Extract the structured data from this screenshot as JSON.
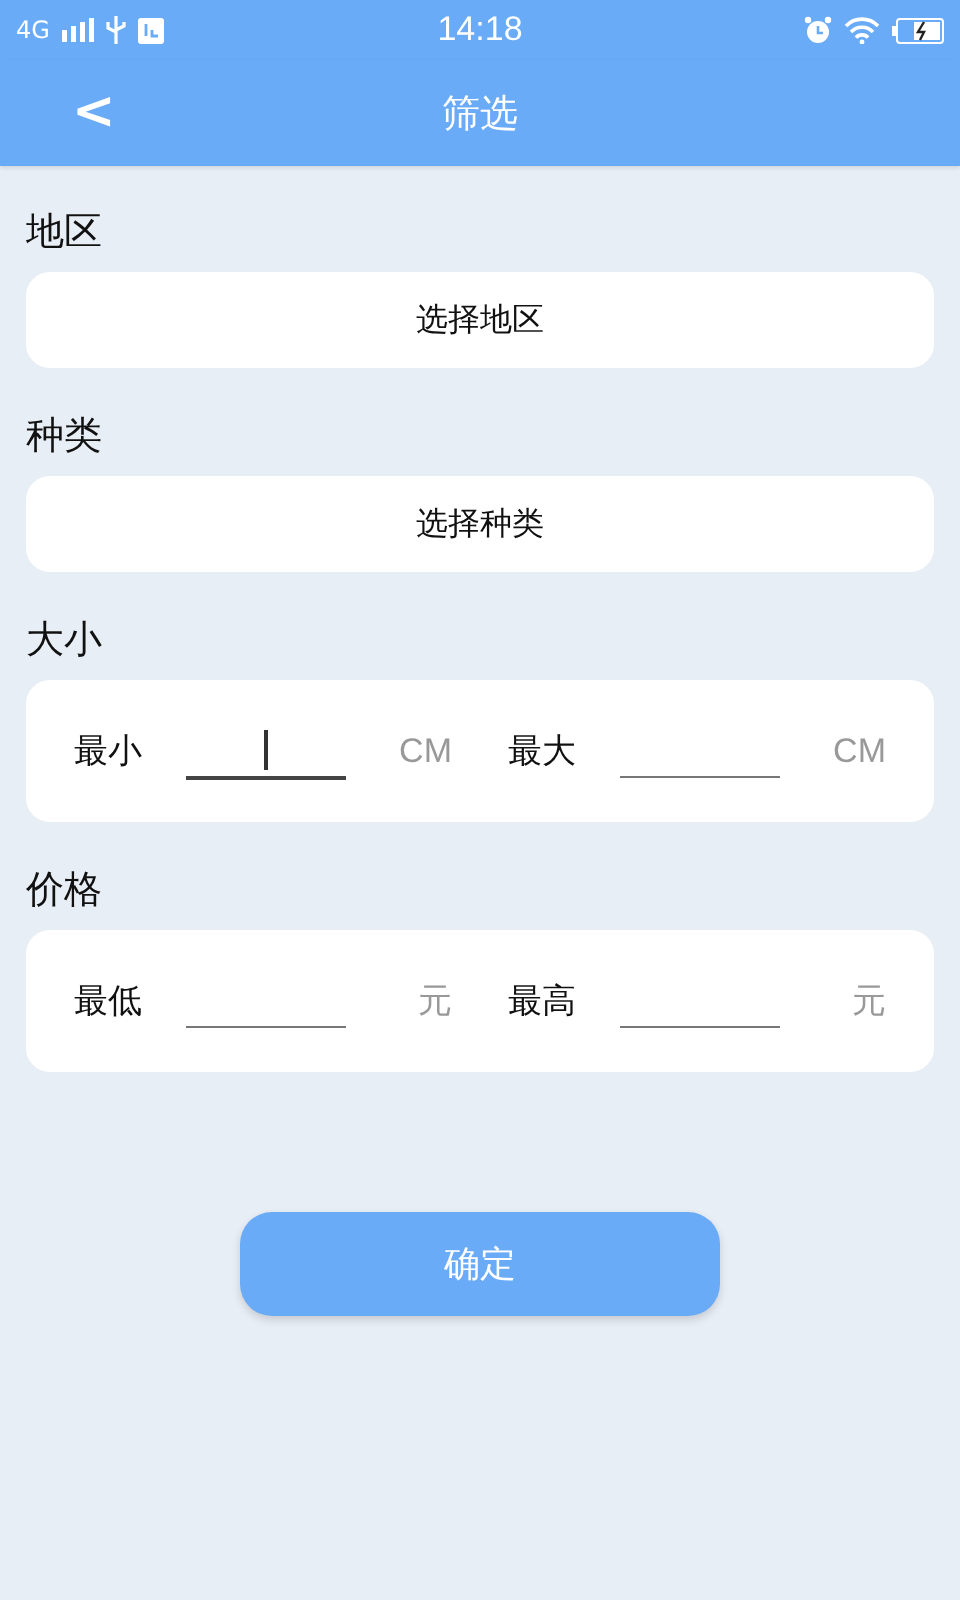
{
  "status_bar": {
    "network": "4G",
    "time": "14:18"
  },
  "header": {
    "back": "<",
    "title": "筛选"
  },
  "sections": [
    {
      "kind": "select",
      "label": "地区",
      "value": "选择地区"
    },
    {
      "kind": "select",
      "label": "种类",
      "value": "选择种类"
    },
    {
      "kind": "range",
      "label": "大小",
      "fields": [
        {
          "label": "最小",
          "unit": "CM",
          "focused": true
        },
        {
          "label": "最大",
          "unit": "CM",
          "focused": false
        }
      ]
    },
    {
      "kind": "range",
      "label": "价格",
      "fields": [
        {
          "label": "最低",
          "unit": "元",
          "focused": false
        },
        {
          "label": "最高",
          "unit": "元",
          "focused": false
        }
      ]
    }
  ],
  "confirm_button": "确定"
}
